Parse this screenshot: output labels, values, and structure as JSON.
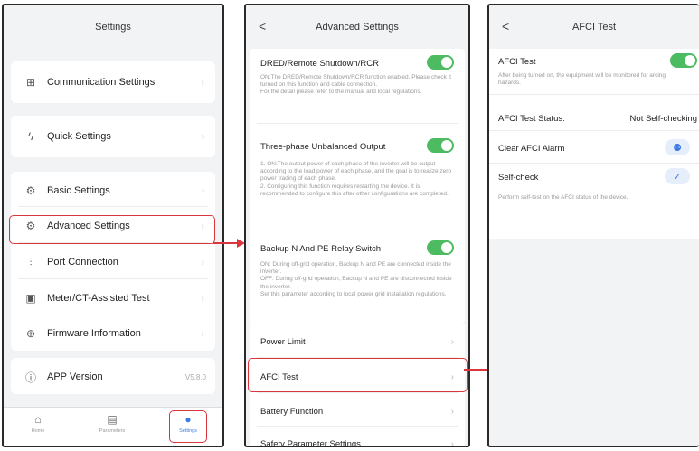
{
  "settings": {
    "title": "Settings",
    "items": [
      {
        "label": "Communication Settings",
        "icon": "network-icon"
      },
      {
        "label": "Quick Settings",
        "icon": "lightning-icon"
      },
      {
        "label": "Basic Settings",
        "icon": "gear-icon"
      },
      {
        "label": "Advanced Settings",
        "icon": "advanced-gear-icon"
      },
      {
        "label": "Port Connection",
        "icon": "port-icon"
      },
      {
        "label": "Meter/CT-Assisted Test",
        "icon": "meter-icon"
      },
      {
        "label": "Firmware Information",
        "icon": "plus-circle-icon"
      },
      {
        "label": "APP Version",
        "icon": "info-icon",
        "value": "V5.8.0"
      }
    ],
    "tabs": [
      {
        "label": "Home",
        "icon": "home-icon"
      },
      {
        "label": "Parameters",
        "icon": "document-icon"
      },
      {
        "label": "Settings",
        "icon": "settings-icon"
      }
    ]
  },
  "advanced": {
    "title": "Advanced Settings",
    "back": "<",
    "dred": {
      "title": "DRED/Remote Shutdown/RCR",
      "desc": "ON:The DRED/Remote Shutdown/RCR function enabled. Please check it turned on this function and cable connection.\nFor the detail please refer to the manual and local regulations."
    },
    "unbalanced": {
      "title": "Three-phase Unbalanced Output",
      "desc": "1. ON:The output power of each phase of the inverter will be output according to the load power of each phase, and the goal is to realize zero power trading of each phase.\n2. Configuring this function requires restarting the device. It is recommended to configure this after other configurations are completed."
    },
    "backup": {
      "title": "Backup N And PE Relay Switch",
      "desc": "ON: During off-grid operation, Backup N and PE are connected inside the inverter.\nOFF: During off-grid operation, Backup N and PE are disconnected inside the inverter.\nSet this parameter according to local power grid installation regulations."
    },
    "links": [
      "Power Limit",
      "AFCI Test",
      "Battery Function",
      "Safety Parameter Settings"
    ]
  },
  "afci": {
    "title": "AFCI Test",
    "back": "<",
    "toggle_label": "AFCI Test",
    "toggle_desc": "After being turned on, the equipment will be monitored for arcing hazards.",
    "status_label": "AFCI Test Status:",
    "status_value": "Not Self-checking",
    "clear_label": "Clear AFCI Alarm",
    "self_check_label": "Self-check",
    "self_check_desc": "Perform self-test on the AFCI status of the device."
  },
  "colors": {
    "toggle_on": "#4cbb61",
    "highlight": "#d9363e",
    "accent_blue": "#3d7be3"
  }
}
